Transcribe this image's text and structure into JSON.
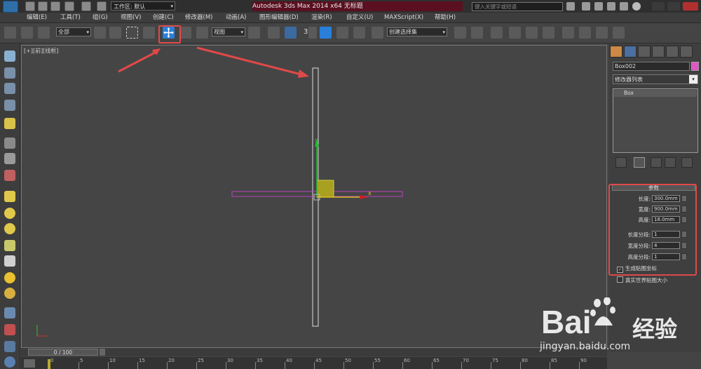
{
  "titlebar": {
    "workspace_label": "工作区: 默认",
    "app_title": "Autodesk 3ds Max  2014 x64      无标题",
    "search_placeholder": "键入关键字或短语"
  },
  "menu": [
    "编辑(E)",
    "工具(T)",
    "组(G)",
    "视图(V)",
    "创建(C)",
    "修改器(M)",
    "动画(A)",
    "图形编辑器(D)",
    "渲染(R)",
    "自定义(U)",
    "MAXScript(X)",
    "帮助(H)"
  ],
  "toolbar": {
    "selection_filter": "全部",
    "ref_coord": "视图",
    "snap_value": "3",
    "named_selection": "创建选择集"
  },
  "viewport": {
    "label": "[+][前][线框]",
    "axis_x": "x",
    "axis_y": "y"
  },
  "command_panel": {
    "object_name": "Box002",
    "object_color": "#e155c8",
    "modifier_list": "修改器列表",
    "stack_item": "Box",
    "params_title": "参数",
    "length_label": "长度:",
    "length_value": "300.0mm",
    "width_label": "宽度:",
    "width_value": "900.0mm",
    "height_label": "高度:",
    "height_value": "18.0mm",
    "length_segs_label": "长度分段:",
    "length_segs_value": "1",
    "width_segs_label": "宽度分段:",
    "width_segs_value": "4",
    "height_segs_label": "高度分段:",
    "height_segs_value": "1",
    "gen_map_coords": "生成贴图坐标",
    "real_world_map": "真实世界贴图大小"
  },
  "timeline": {
    "slider_text": "0 / 100",
    "ticks": [
      "0",
      "5",
      "10",
      "15",
      "20",
      "25",
      "30",
      "35",
      "40",
      "45",
      "50",
      "55",
      "60",
      "65",
      "70",
      "75",
      "80",
      "85",
      "90"
    ]
  },
  "watermark": {
    "brand": "Bai",
    "brand_cn": "经验",
    "url": "jingyan.baidu.com"
  },
  "colors": {
    "annotation_red": "#e04949",
    "active_tool_blue": "#2a7fd8"
  }
}
